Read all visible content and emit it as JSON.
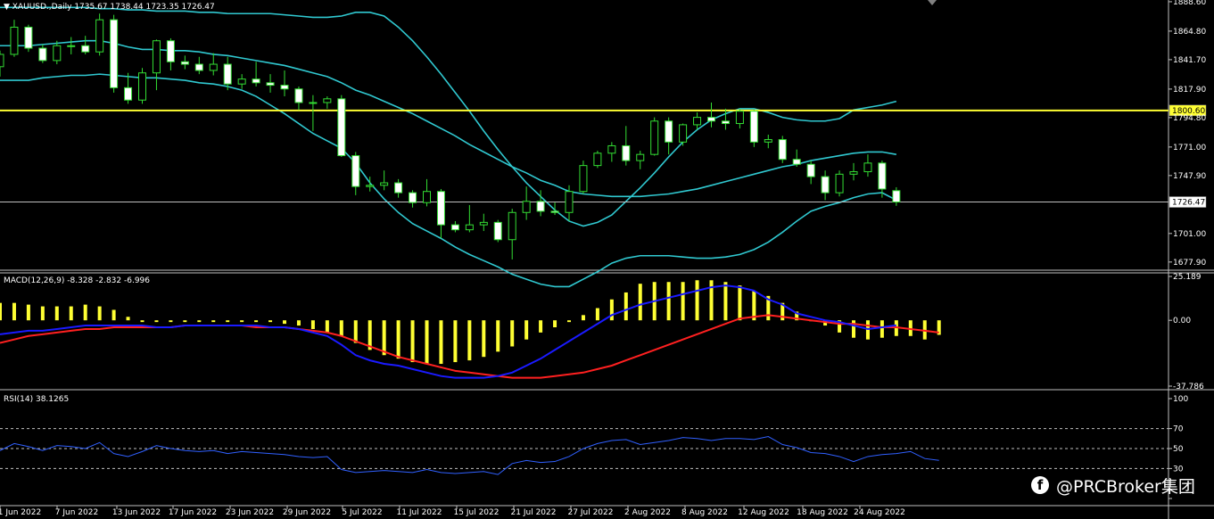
{
  "window": {
    "symbol_header": "XAUUSD.,Daily",
    "ohlc_header": "1735.67 1738.44 1723.35 1726.47"
  },
  "chart_data": [
    {
      "type": "candlestick",
      "name": "XAUUSD.,Daily",
      "y_ticks": [
        "1888.60",
        "1864.80",
        "1841.70",
        "1817.90",
        "1794.80",
        "1771.00",
        "1747.90",
        "1701.00",
        "1677.90"
      ],
      "ylim": [
        1672,
        1890
      ],
      "x_tick_labels": [
        "1 Jun 2022",
        "7 Jun 2022",
        "13 Jun 2022",
        "17 Jun 2022",
        "23 Jun 2022",
        "29 Jun 2022",
        "5 Jul 2022",
        "11 Jul 2022",
        "15 Jul 2022",
        "21 Jul 2022",
        "27 Jul 2022",
        "2 Aug 2022",
        "8 Aug 2022",
        "12 Aug 2022",
        "18 Aug 2022",
        "24 Aug 2022"
      ],
      "horizontal_levels": [
        {
          "label": "1800.60",
          "value": 1800.6,
          "color": "#ffff33"
        },
        {
          "label": "1726.47",
          "value": 1726.47,
          "color": "#c0c0c0"
        }
      ],
      "colors": {
        "bull_body": "#000000",
        "bear_body": "#ffffff",
        "wick": "#33dd33",
        "bands": "#30c8d0"
      },
      "bars": [
        {
          "date": "1 Jun",
          "o": 1836,
          "h": 1849,
          "l": 1828,
          "c": 1846
        },
        {
          "date": "2 Jun",
          "o": 1846,
          "h": 1874,
          "l": 1844,
          "c": 1868
        },
        {
          "date": "3 Jun",
          "o": 1868,
          "h": 1870,
          "l": 1848,
          "c": 1851
        },
        {
          "date": "6 Jun",
          "o": 1851,
          "h": 1854,
          "l": 1839,
          "c": 1841
        },
        {
          "date": "7 Jun",
          "o": 1841,
          "h": 1857,
          "l": 1838,
          "c": 1853
        },
        {
          "date": "8 Jun",
          "o": 1853,
          "h": 1860,
          "l": 1846,
          "c": 1853
        },
        {
          "date": "9 Jun",
          "o": 1853,
          "h": 1861,
          "l": 1846,
          "c": 1848
        },
        {
          "date": "10 Jun",
          "o": 1848,
          "h": 1879,
          "l": 1845,
          "c": 1874
        },
        {
          "date": "13 Jun",
          "o": 1874,
          "h": 1878,
          "l": 1815,
          "c": 1819
        },
        {
          "date": "14 Jun",
          "o": 1819,
          "h": 1831,
          "l": 1806,
          "c": 1809
        },
        {
          "date": "15 Jun",
          "o": 1809,
          "h": 1835,
          "l": 1806,
          "c": 1831
        },
        {
          "date": "16 Jun",
          "o": 1831,
          "h": 1858,
          "l": 1817,
          "c": 1857
        },
        {
          "date": "17 Jun",
          "o": 1857,
          "h": 1859,
          "l": 1833,
          "c": 1840
        },
        {
          "date": "20 Jun",
          "o": 1840,
          "h": 1845,
          "l": 1834,
          "c": 1838
        },
        {
          "date": "21 Jun",
          "o": 1838,
          "h": 1844,
          "l": 1830,
          "c": 1833
        },
        {
          "date": "22 Jun",
          "o": 1833,
          "h": 1847,
          "l": 1829,
          "c": 1838
        },
        {
          "date": "23 Jun",
          "o": 1838,
          "h": 1844,
          "l": 1817,
          "c": 1822
        },
        {
          "date": "24 Jun",
          "o": 1822,
          "h": 1830,
          "l": 1818,
          "c": 1826
        },
        {
          "date": "27 Jun",
          "o": 1826,
          "h": 1840,
          "l": 1820,
          "c": 1823
        },
        {
          "date": "28 Jun",
          "o": 1823,
          "h": 1830,
          "l": 1815,
          "c": 1821
        },
        {
          "date": "29 Jun",
          "o": 1821,
          "h": 1833,
          "l": 1812,
          "c": 1818
        },
        {
          "date": "30 Jun",
          "o": 1818,
          "h": 1820,
          "l": 1801,
          "c": 1807
        },
        {
          "date": "1 Jul",
          "o": 1807,
          "h": 1813,
          "l": 1784,
          "c": 1807
        },
        {
          "date": "4 Jul",
          "o": 1807,
          "h": 1812,
          "l": 1802,
          "c": 1810
        },
        {
          "date": "5 Jul",
          "o": 1810,
          "h": 1813,
          "l": 1763,
          "c": 1764
        },
        {
          "date": "6 Jul",
          "o": 1764,
          "h": 1767,
          "l": 1732,
          "c": 1739
        },
        {
          "date": "7 Jul",
          "o": 1739,
          "h": 1747,
          "l": 1735,
          "c": 1740
        },
        {
          "date": "8 Jul",
          "o": 1740,
          "h": 1752,
          "l": 1736,
          "c": 1742
        },
        {
          "date": "11 Jul",
          "o": 1742,
          "h": 1745,
          "l": 1730,
          "c": 1734
        },
        {
          "date": "12 Jul",
          "o": 1734,
          "h": 1736,
          "l": 1722,
          "c": 1726
        },
        {
          "date": "13 Jul",
          "o": 1726,
          "h": 1745,
          "l": 1723,
          "c": 1735
        },
        {
          "date": "14 Jul",
          "o": 1735,
          "h": 1737,
          "l": 1697,
          "c": 1708
        },
        {
          "date": "15 Jul",
          "o": 1708,
          "h": 1711,
          "l": 1702,
          "c": 1704
        },
        {
          "date": "18 Jul",
          "o": 1704,
          "h": 1724,
          "l": 1702,
          "c": 1708
        },
        {
          "date": "19 Jul",
          "o": 1708,
          "h": 1717,
          "l": 1703,
          "c": 1710
        },
        {
          "date": "20 Jul",
          "o": 1710,
          "h": 1712,
          "l": 1694,
          "c": 1696
        },
        {
          "date": "21 Jul",
          "o": 1696,
          "h": 1721,
          "l": 1680,
          "c": 1718
        },
        {
          "date": "22 Jul",
          "o": 1718,
          "h": 1739,
          "l": 1712,
          "c": 1727
        },
        {
          "date": "25 Jul",
          "o": 1727,
          "h": 1736,
          "l": 1715,
          "c": 1719
        },
        {
          "date": "26 Jul",
          "o": 1719,
          "h": 1726,
          "l": 1716,
          "c": 1718
        },
        {
          "date": "27 Jul",
          "o": 1718,
          "h": 1740,
          "l": 1711,
          "c": 1735
        },
        {
          "date": "28 Jul",
          "o": 1735,
          "h": 1760,
          "l": 1733,
          "c": 1756
        },
        {
          "date": "29 Jul",
          "o": 1756,
          "h": 1768,
          "l": 1754,
          "c": 1766
        },
        {
          "date": "1 Aug",
          "o": 1766,
          "h": 1775,
          "l": 1759,
          "c": 1772
        },
        {
          "date": "2 Aug",
          "o": 1772,
          "h": 1788,
          "l": 1756,
          "c": 1760
        },
        {
          "date": "3 Aug",
          "o": 1760,
          "h": 1768,
          "l": 1753,
          "c": 1765
        },
        {
          "date": "4 Aug",
          "o": 1765,
          "h": 1795,
          "l": 1764,
          "c": 1792
        },
        {
          "date": "5 Aug",
          "o": 1792,
          "h": 1795,
          "l": 1765,
          "c": 1775
        },
        {
          "date": "8 Aug",
          "o": 1775,
          "h": 1790,
          "l": 1772,
          "c": 1789
        },
        {
          "date": "9 Aug",
          "o": 1789,
          "h": 1799,
          "l": 1785,
          "c": 1795
        },
        {
          "date": "10 Aug",
          "o": 1795,
          "h": 1807,
          "l": 1787,
          "c": 1792
        },
        {
          "date": "11 Aug",
          "o": 1792,
          "h": 1802,
          "l": 1785,
          "c": 1790
        },
        {
          "date": "12 Aug",
          "o": 1790,
          "h": 1802,
          "l": 1786,
          "c": 1800
        },
        {
          "date": "15 Aug",
          "o": 1800,
          "h": 1801,
          "l": 1771,
          "c": 1775
        },
        {
          "date": "16 Aug",
          "o": 1775,
          "h": 1781,
          "l": 1770,
          "c": 1777
        },
        {
          "date": "17 Aug",
          "o": 1777,
          "h": 1780,
          "l": 1758,
          "c": 1761
        },
        {
          "date": "18 Aug",
          "o": 1761,
          "h": 1769,
          "l": 1755,
          "c": 1757
        },
        {
          "date": "19 Aug",
          "o": 1757,
          "h": 1760,
          "l": 1741,
          "c": 1747
        },
        {
          "date": "22 Aug",
          "o": 1747,
          "h": 1752,
          "l": 1728,
          "c": 1734
        },
        {
          "date": "23 Aug",
          "o": 1734,
          "h": 1752,
          "l": 1731,
          "c": 1749
        },
        {
          "date": "24 Aug",
          "o": 1749,
          "h": 1758,
          "l": 1744,
          "c": 1751
        },
        {
          "date": "25 Aug",
          "o": 1751,
          "h": 1765,
          "l": 1747,
          "c": 1758
        },
        {
          "date": "26 Aug",
          "o": 1758,
          "h": 1760,
          "l": 1730,
          "c": 1737
        },
        {
          "date": "29 Aug",
          "o": 1735.67,
          "h": 1738.44,
          "l": 1723.35,
          "c": 1726.47
        }
      ],
      "bollinger": {
        "upper": [
          1884,
          1884,
          1884,
          1884,
          1884,
          1884,
          1884,
          1883,
          1883,
          1882,
          1882,
          1881,
          1881,
          1881,
          1880,
          1880,
          1879,
          1879,
          1879,
          1879,
          1878,
          1877,
          1876,
          1876,
          1877,
          1880,
          1880,
          1877,
          1868,
          1857,
          1844,
          1830,
          1815,
          1800,
          1784,
          1769,
          1755,
          1742,
          1731,
          1720,
          1711,
          1707,
          1710,
          1716,
          1727,
          1738,
          1750,
          1763,
          1775,
          1785,
          1793,
          1798,
          1802,
          1802,
          1799,
          1795,
          1793,
          1792,
          1792,
          1794,
          1801,
          1803,
          1805,
          1808
        ],
        "middle": [
          1853,
          1853,
          1853,
          1854,
          1855,
          1856,
          1857,
          1857,
          1855,
          1852,
          1850,
          1850,
          1849,
          1849,
          1848,
          1846,
          1845,
          1843,
          1841,
          1839,
          1837,
          1834,
          1831,
          1828,
          1823,
          1817,
          1813,
          1808,
          1803,
          1798,
          1792,
          1786,
          1780,
          1773,
          1767,
          1761,
          1755,
          1750,
          1744,
          1740,
          1735,
          1733,
          1732,
          1731,
          1731,
          1731,
          1732,
          1733,
          1735,
          1737,
          1740,
          1743,
          1746,
          1749,
          1752,
          1755,
          1757,
          1760,
          1762,
          1764,
          1766,
          1767,
          1767,
          1765
        ],
        "lower": [
          1825,
          1825,
          1825,
          1827,
          1828,
          1829,
          1829,
          1830,
          1829,
          1828,
          1827,
          1827,
          1826,
          1825,
          1823,
          1822,
          1820,
          1817,
          1812,
          1805,
          1798,
          1790,
          1782,
          1776,
          1770,
          1758,
          1742,
          1729,
          1718,
          1709,
          1703,
          1697,
          1690,
          1684,
          1679,
          1674,
          1668,
          1664,
          1660,
          1658,
          1658,
          1664,
          1670,
          1677,
          1681,
          1683,
          1683,
          1683,
          1682,
          1681,
          1681,
          1682,
          1684,
          1688,
          1694,
          1702,
          1711,
          1719,
          1723,
          1726,
          1730,
          1733,
          1734,
          1728
        ]
      }
    },
    {
      "type": "bar+line",
      "name": "MACD(12,26,9)",
      "header_values": "-8.328 -2.832 -6.996",
      "y_ticks": [
        "25.189",
        "0.00",
        "-37.786"
      ],
      "ylim": [
        -37.786,
        25.189
      ],
      "series": [
        {
          "name": "MACD",
          "color": "#ffff33",
          "values": [
            10,
            10,
            9,
            8,
            8,
            8,
            9,
            8,
            6,
            2,
            -1,
            -1,
            -1,
            -1,
            -1,
            -1,
            -1,
            -1,
            -1,
            -1,
            -2,
            -3,
            -5,
            -7,
            -9,
            -13,
            -17,
            -20,
            -22,
            -24,
            -25,
            -25,
            -24,
            -23,
            -21,
            -18,
            -15,
            -11,
            -7,
            -4,
            -1,
            3,
            7,
            12,
            16,
            21,
            22,
            22,
            22,
            23,
            23,
            22,
            20,
            17,
            14,
            10,
            5,
            0,
            -3,
            -7,
            -10,
            -11,
            -10,
            -9,
            -9,
            -11,
            -8.328
          ]
        },
        {
          "name": "Signal",
          "color": "#ff2020",
          "values": [
            -13,
            -11,
            -9,
            -8,
            -7,
            -6,
            -5,
            -5,
            -4,
            -4,
            -4,
            -4,
            -4,
            -3,
            -3,
            -3,
            -3,
            -3,
            -4,
            -4,
            -4,
            -5,
            -6,
            -7,
            -9,
            -12,
            -15,
            -18,
            -21,
            -23,
            -25,
            -27,
            -29,
            -30,
            -31,
            -32,
            -33,
            -33,
            -33,
            -32,
            -31,
            -30,
            -28,
            -26,
            -23,
            -20,
            -17,
            -14,
            -11,
            -8,
            -5,
            -2,
            1,
            2,
            3,
            2,
            1,
            0,
            -1,
            -2,
            -2,
            -3,
            -4,
            -4,
            -5,
            -6,
            -6.996
          ]
        },
        {
          "name": "Main",
          "color": "#1a1aff",
          "values": [
            -8,
            -7,
            -6,
            -6,
            -5,
            -4,
            -3,
            -3,
            -3,
            -3,
            -3,
            -4,
            -4,
            -3,
            -3,
            -3,
            -3,
            -3,
            -3,
            -4,
            -4,
            -5,
            -7,
            -9,
            -14,
            -20,
            -23,
            -25,
            -26,
            -28,
            -30,
            -32,
            -33,
            -33,
            -33,
            -32,
            -30,
            -26,
            -22,
            -17,
            -12,
            -7,
            -2,
            3,
            6,
            9,
            11,
            13,
            15,
            17,
            19,
            20,
            19,
            17,
            12,
            9,
            4,
            2,
            0,
            -1,
            -3,
            -5,
            -4,
            -2.832
          ]
        }
      ]
    },
    {
      "type": "line",
      "name": "RSI(14)",
      "header_values": "38.1265",
      "y_ticks": [
        "100",
        "70",
        "50",
        "30",
        "0"
      ],
      "ylim": [
        0,
        100
      ],
      "levels": [
        70,
        50,
        30
      ],
      "series": [
        {
          "name": "RSI",
          "color": "#3060ff",
          "values": [
            48,
            55,
            52,
            48,
            53,
            52,
            50,
            56,
            45,
            42,
            47,
            53,
            50,
            48,
            47,
            48,
            45,
            47,
            46,
            45,
            44,
            42,
            41,
            42,
            29,
            26,
            27,
            28,
            27,
            26,
            29,
            26,
            25,
            26,
            27,
            24,
            35,
            38,
            36,
            37,
            42,
            50,
            55,
            58,
            59,
            54,
            56,
            58,
            61,
            60,
            58,
            60,
            60,
            59,
            62,
            54,
            51,
            46,
            45,
            42,
            37,
            42,
            44,
            45,
            47,
            40,
            38.1265
          ]
        }
      ]
    }
  ],
  "watermark": {
    "icon": "facebook-icon",
    "text": "@PRCBroker集团"
  }
}
